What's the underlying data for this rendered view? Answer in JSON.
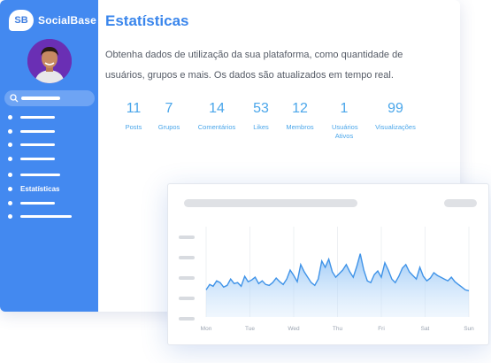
{
  "brand": {
    "badge": "SB",
    "name": "SocialBase"
  },
  "sidebar": {
    "search_icon": "search-icon",
    "items": [
      {
        "label": ""
      },
      {
        "label": ""
      },
      {
        "label": ""
      },
      {
        "label": ""
      },
      {
        "label": ""
      },
      {
        "label": "Estatísticas"
      },
      {
        "label": ""
      },
      {
        "label": ""
      }
    ]
  },
  "page": {
    "title": "Estatísticas",
    "description": "Obtenha dados de utilização da sua plataforma, como quantidade de usuários, grupos e mais. Os dados são atualizados em tempo real."
  },
  "stats": [
    {
      "value": "11",
      "label": "Posts"
    },
    {
      "value": "7",
      "label": "Grupos"
    },
    {
      "value": "14",
      "label": "Comentários"
    },
    {
      "value": "53",
      "label": "Likes"
    },
    {
      "value": "12",
      "label": "Membros"
    },
    {
      "value": "1",
      "label": "Usuários Ativos"
    },
    {
      "value": "99",
      "label": "Visualizações"
    }
  ],
  "colors": {
    "sidebar": "#4389f0",
    "accent": "#3a86ec",
    "stat": "#4aa6ea"
  },
  "chart_data": {
    "type": "area",
    "categories": [
      "Mon",
      "Tue",
      "Wed",
      "Thu",
      "Fri",
      "Sat",
      "Sun"
    ],
    "values": [
      0.3,
      0.36,
      0.34,
      0.4,
      0.38,
      0.33,
      0.35,
      0.42,
      0.37,
      0.38,
      0.34,
      0.45,
      0.39,
      0.41,
      0.44,
      0.37,
      0.4,
      0.36,
      0.35,
      0.38,
      0.43,
      0.39,
      0.36,
      0.42,
      0.52,
      0.46,
      0.39,
      0.58,
      0.5,
      0.44,
      0.38,
      0.35,
      0.42,
      0.62,
      0.55,
      0.64,
      0.5,
      0.44,
      0.48,
      0.52,
      0.58,
      0.5,
      0.44,
      0.56,
      0.7,
      0.52,
      0.4,
      0.38,
      0.47,
      0.51,
      0.44,
      0.6,
      0.52,
      0.42,
      0.38,
      0.45,
      0.54,
      0.58,
      0.5,
      0.46,
      0.42,
      0.55,
      0.45,
      0.4,
      0.43,
      0.49,
      0.46,
      0.44,
      0.42,
      0.4,
      0.44,
      0.39,
      0.36,
      0.33,
      0.3,
      0.29
    ],
    "grid": true
  }
}
